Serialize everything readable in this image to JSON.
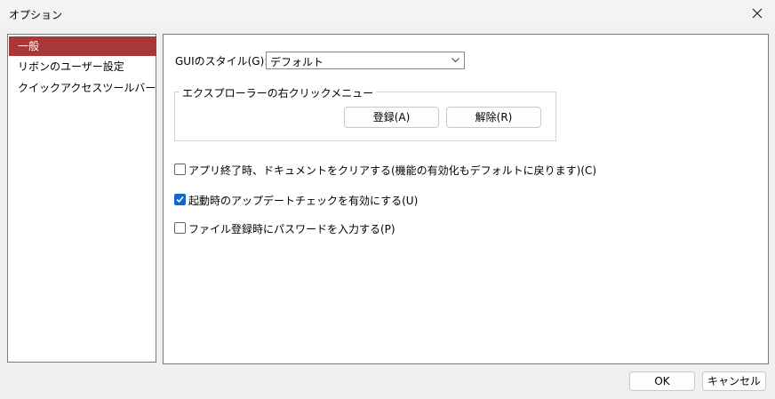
{
  "window": {
    "title": "オプション"
  },
  "sidebar": {
    "items": [
      {
        "label": "一般",
        "selected": true
      },
      {
        "label": "リボンのユーザー設定",
        "selected": false
      },
      {
        "label": "クイックアクセスツールバー",
        "selected": false
      }
    ]
  },
  "general": {
    "gui_style_label": "GUIのスタイル(G):",
    "gui_style_value": "デフォルト",
    "explorer_group_label": "エクスプローラーの右クリックメニュー",
    "register_label": "登録(A)",
    "unregister_label": "解除(R)",
    "options": [
      {
        "label": "アプリ終了時、ドキュメントをクリアする(機能の有効化もデフォルトに戻ります)(C)",
        "checked": false
      },
      {
        "label": "起動時のアップデートチェックを有効にする(U)",
        "checked": true
      },
      {
        "label": "ファイル登録時にパスワードを入力する(P)",
        "checked": false
      }
    ]
  },
  "footer": {
    "ok_label": "OK",
    "cancel_label": "キャンセル"
  },
  "colors": {
    "selected_bg": "#a83838",
    "check_blue": "#1964c8"
  },
  "icons": {
    "close": "close-icon",
    "dropdown": "chevron-down-icon",
    "check": "checkmark-icon"
  }
}
